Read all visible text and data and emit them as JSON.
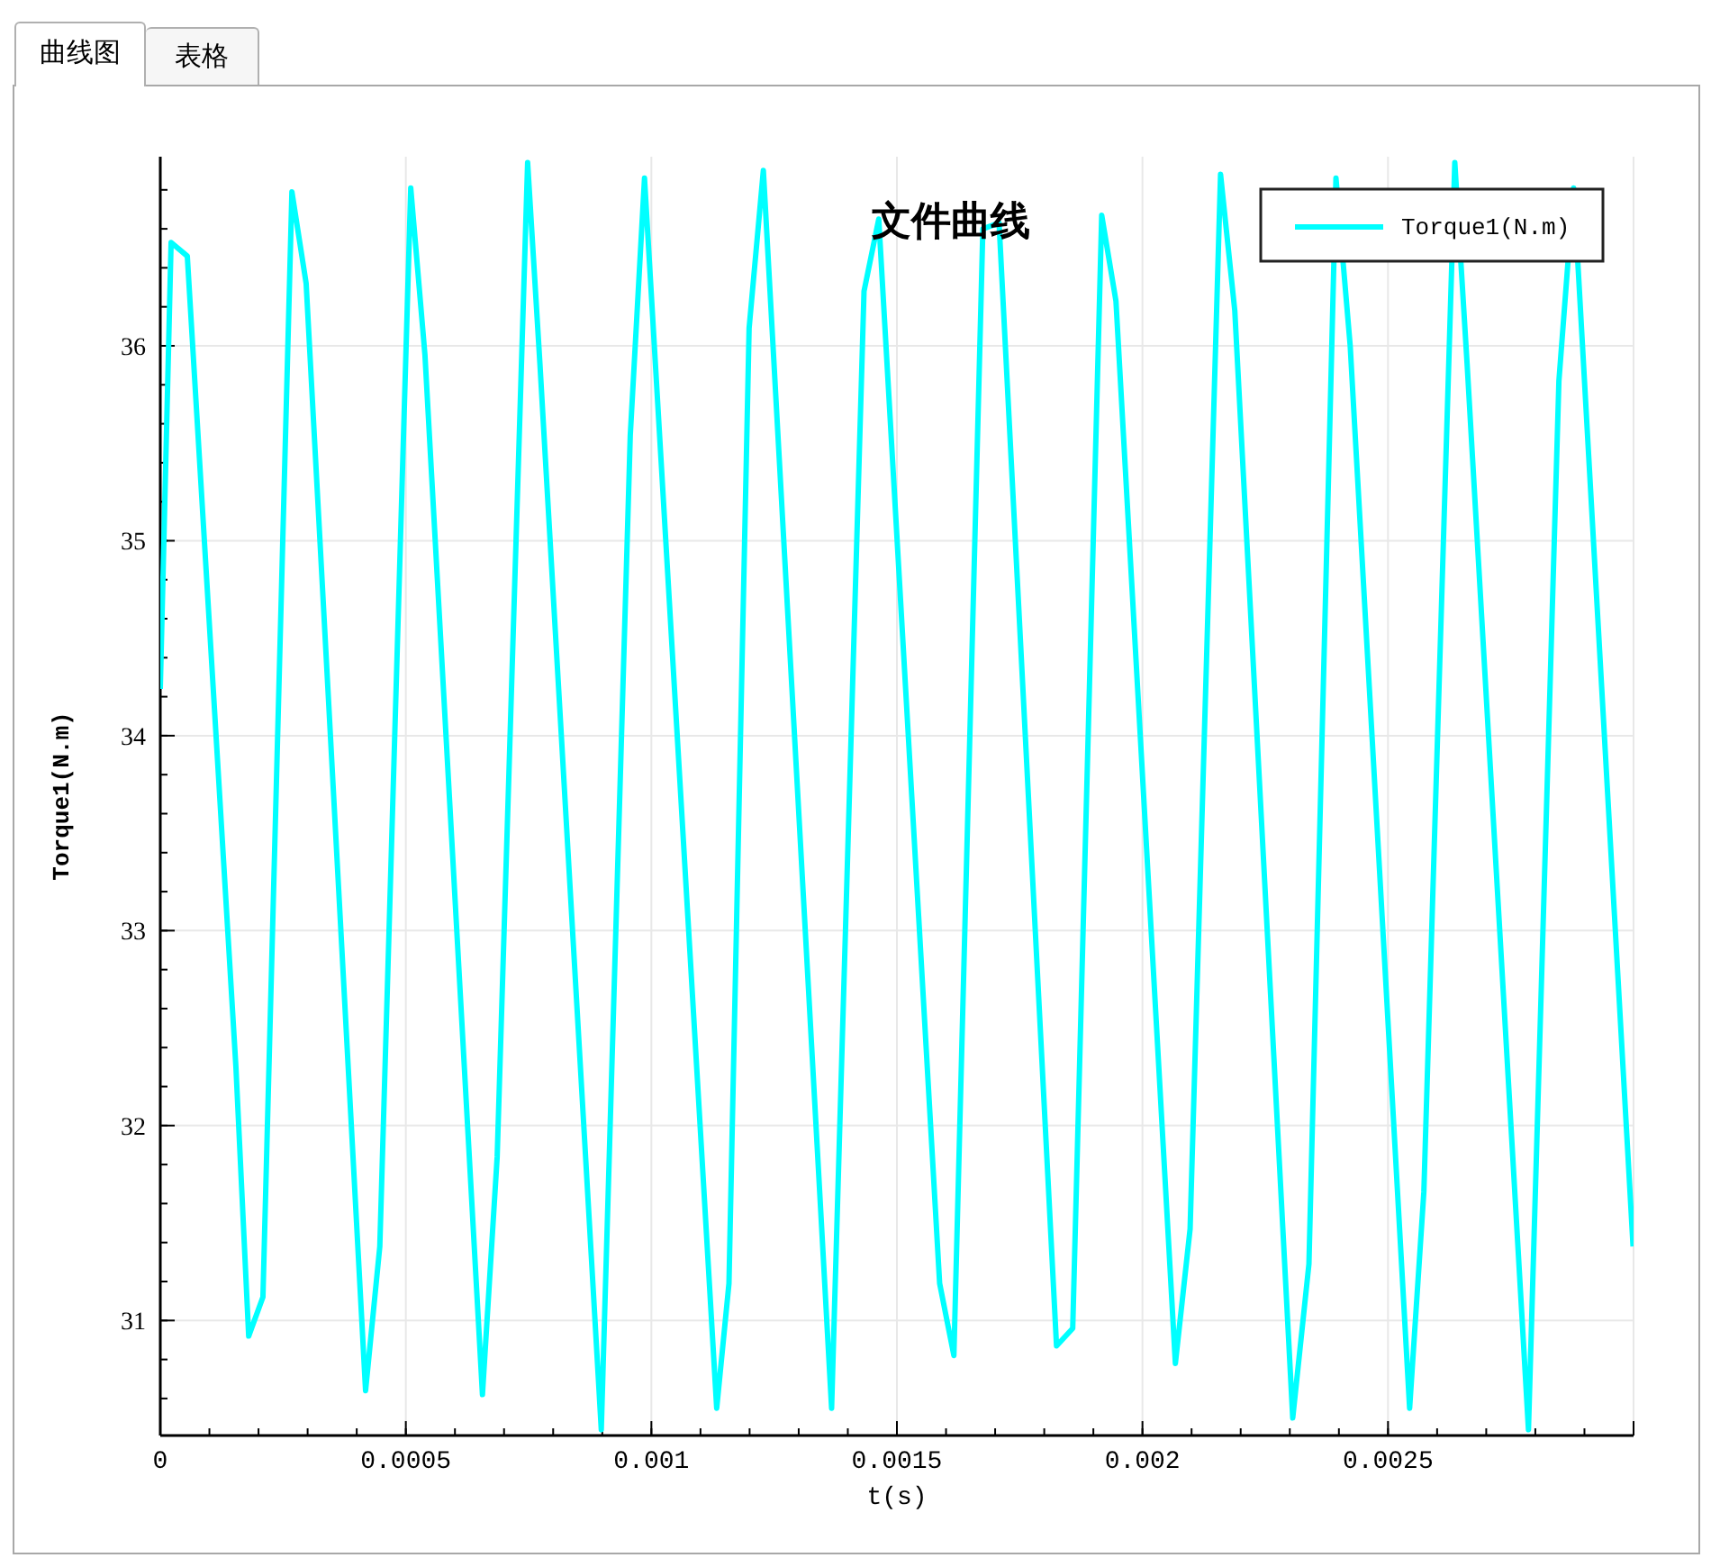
{
  "tabs": [
    {
      "label": "曲线图",
      "selected": true
    },
    {
      "label": "表格",
      "selected": false
    }
  ],
  "chart_data": {
    "type": "line",
    "grid": true,
    "title": "文件曲线",
    "xlabel": "t(s)",
    "ylabel": "Torque1(N.m)",
    "xlim": [
      0,
      0.003
    ],
    "ylim": [
      30.41,
      36.97
    ],
    "xticks": [
      {
        "value": 0,
        "label": "0"
      },
      {
        "value": 0.0005,
        "label": "0.0005"
      },
      {
        "value": 0.001,
        "label": "0.001"
      },
      {
        "value": 0.0015,
        "label": "0.0015"
      },
      {
        "value": 0.002,
        "label": "0.002"
      },
      {
        "value": 0.0025,
        "label": "0.0025"
      }
    ],
    "yticks": [
      {
        "value": 31,
        "label": "31"
      },
      {
        "value": 32,
        "label": "32"
      },
      {
        "value": 33,
        "label": "33"
      },
      {
        "value": 34,
        "label": "34"
      },
      {
        "value": 35,
        "label": "35"
      },
      {
        "value": 36,
        "label": "36"
      }
    ],
    "x": [
      0,
      2.2e-05,
      5.5e-05,
      0.000154,
      0.00018,
      0.000209,
      0.000268,
      0.000297,
      0.000418,
      0.000447,
      0.00051,
      0.000539,
      0.000656,
      0.000686,
      0.000748,
      0.000773,
      0.000898,
      0.000957,
      0.000986,
      0.001133,
      0.001158,
      0.001199,
      0.001228,
      0.001367,
      0.001433,
      0.001463,
      0.001587,
      0.001616,
      0.001675,
      0.001708,
      0.001825,
      0.001858,
      0.001917,
      0.001946,
      0.002067,
      0.002097,
      0.002159,
      0.002188,
      0.002306,
      0.002339,
      0.002394,
      0.002423,
      0.002544,
      0.002573,
      0.002636,
      0.002661,
      0.002786,
      0.002848,
      0.002878,
      0.002999
    ],
    "series": [
      {
        "name": "Torque1(N.m)",
        "color": "#00ffff",
        "values": [
          34.24,
          36.53,
          36.46,
          32.3,
          30.92,
          31.12,
          36.79,
          36.32,
          30.64,
          31.38,
          36.81,
          35.95,
          30.62,
          31.84,
          36.94,
          35.91,
          30.44,
          35.54,
          36.86,
          30.55,
          31.19,
          36.09,
          36.9,
          30.55,
          36.28,
          36.65,
          31.19,
          30.82,
          36.6,
          36.63,
          30.87,
          30.96,
          36.67,
          36.23,
          30.78,
          31.47,
          36.88,
          36.18,
          30.5,
          31.29,
          36.86,
          36,
          30.55,
          31.66,
          36.94,
          35.91,
          30.44,
          35.82,
          36.81,
          31.38
        ]
      }
    ]
  }
}
